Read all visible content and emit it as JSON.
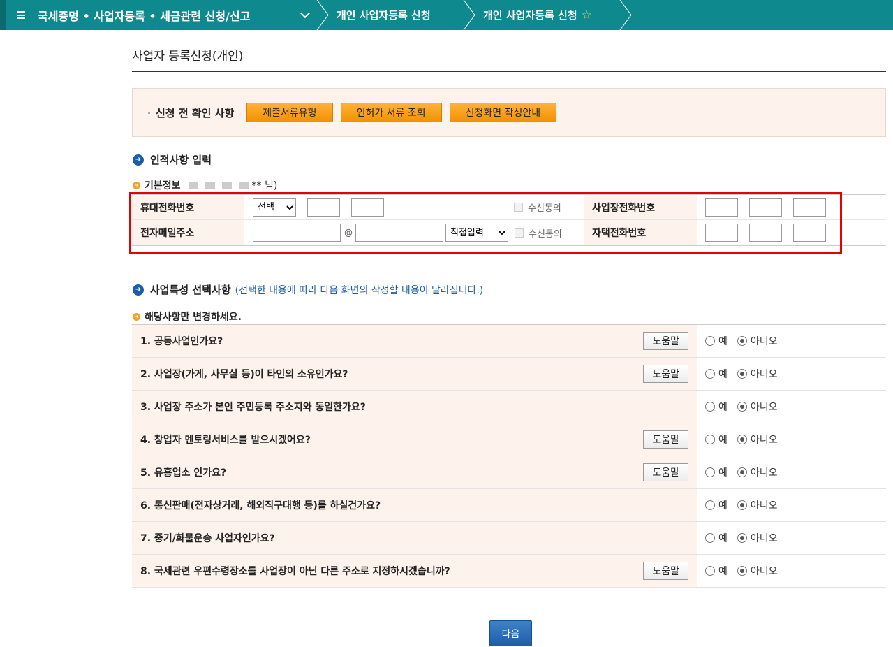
{
  "nav": {
    "menu_title": "국세증명 • 사업자등록 • 세금관련 신청/신고",
    "crumb1": "개인 사업자등록 신청",
    "crumb2": "개인 사업자등록 신청",
    "star": "☆"
  },
  "page_title": "사업자 등록신청(개인)",
  "notice": {
    "label": "신청 전 확인 사항",
    "buttons": [
      "제출서류유형",
      "인허가 서류 조회",
      "신청화면 작성안내"
    ]
  },
  "personal": {
    "heading": "인적사항 입력",
    "basic_label": "기본정보",
    "name_masked": "** 님)",
    "mobile_label": "휴대전화번호",
    "mobile_select": "선택",
    "email_label": "전자메일주소",
    "email_at": "@",
    "email_domain_select": "직접입력",
    "consent_label": "수신동의",
    "biz_phone_label": "사업장전화번호",
    "home_phone_label": "자택전화번호",
    "dash": "–"
  },
  "business": {
    "heading": "사업특성 선택사항",
    "note": "(선택한 내용에 따라 다음 화면의 작성할 내용이 달라집니다.)",
    "sub_heading": "해당사항만 변경하세요.",
    "help_label": "도움말",
    "yes_label": "예",
    "no_label": "아니오",
    "questions": [
      {
        "text": "1. 공동사업인가요?",
        "help": true
      },
      {
        "text": "2. 사업장(가게, 사무실 등)이 타인의 소유인가요?",
        "help": true
      },
      {
        "text": "3. 사업장 주소가 본인 주민등록 주소지와 동일한가요?",
        "help": false
      },
      {
        "text": "4. 창업자 멘토링서비스를 받으시겠어요?",
        "help": true
      },
      {
        "text": "5. 유흥업소 인가요?",
        "help": true
      },
      {
        "text": "6. 통신판매(전자상거래, 해외직구대행 등)를 하실건가요?",
        "help": false
      },
      {
        "text": "7. 중기/화물운송 사업자인가요?",
        "help": false
      },
      {
        "text": "8. 국세관련 우편수령장소를 사업장이 아닌 다른 주소로 지정하시겠습니까?",
        "help": true
      }
    ]
  },
  "next_label": "다음"
}
